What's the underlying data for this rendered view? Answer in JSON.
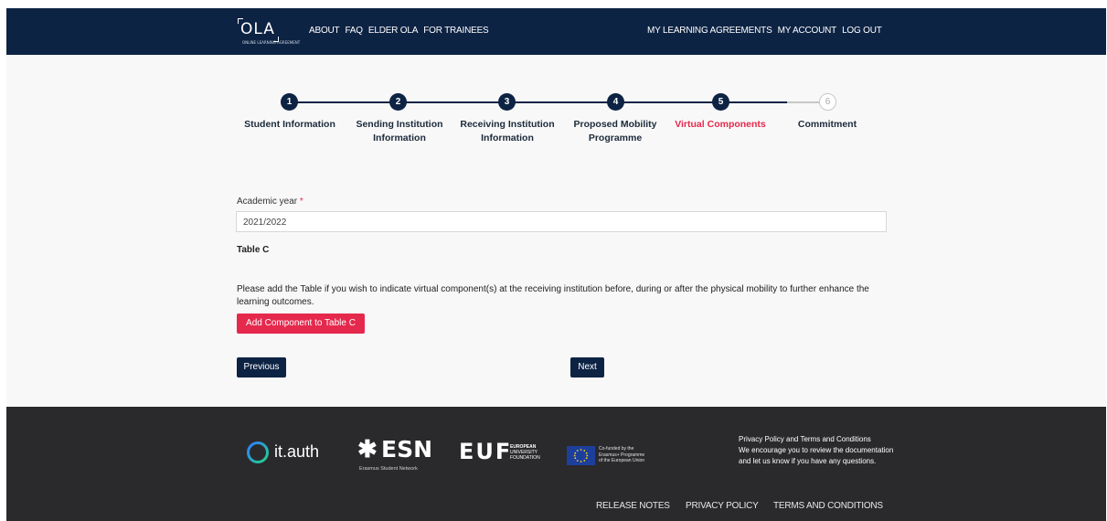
{
  "header": {
    "logo": "OLA",
    "logo_tagline": "ONLINE LEARNING AGREEMENT",
    "nav_left": [
      "ABOUT",
      "FAQ",
      "ELDER OLA",
      "FOR TRAINEES"
    ],
    "nav_right": [
      "MY LEARNING AGREEMENTS",
      "MY ACCOUNT",
      "LOG OUT"
    ]
  },
  "stepper": {
    "current_step": 5,
    "steps": [
      {
        "number": "1",
        "label": "Student Information"
      },
      {
        "number": "2",
        "label": "Sending Institution Information"
      },
      {
        "number": "3",
        "label": "Receiving Institution Information"
      },
      {
        "number": "4",
        "label": "Proposed Mobility Programme"
      },
      {
        "number": "5",
        "label": "Virtual Components"
      },
      {
        "number": "6",
        "label": "Commitment"
      }
    ]
  },
  "form": {
    "academic_year_label": "Academic year",
    "required_mark": "*",
    "academic_year_value": "2021/2022",
    "table_title": "Table C",
    "description": "Please add the Table if you wish to indicate virtual component(s) at the receiving institution before, during or after the physical mobility to further enhance the learning outcomes.",
    "add_button": "Add Component to Table C",
    "previous_button": "Previous",
    "next_button": "Next"
  },
  "footer": {
    "logos": {
      "itauth": "it.auth",
      "esn": "ESN",
      "esn_sub": "Erasmus Student Network",
      "euf": "EUF",
      "euf_sub": [
        "EUROPEAN",
        "UNIVERSITY",
        "FOUNDATION"
      ],
      "eu_text": [
        "Co-funded by the",
        "Erasmus+ Programme",
        "of the European Union"
      ]
    },
    "privacy_title": "Privacy Policy and Terms and Conditions",
    "privacy_text": "We encourage you to review the documentation and let us know if you have any questions.",
    "links": [
      "RELEASE NOTES",
      "PRIVACY POLICY",
      "TERMS AND CONDITIONS"
    ]
  },
  "colors": {
    "navy": "#0d2344",
    "accent": "#e5294d",
    "footer_bg": "#2a2a2d"
  }
}
